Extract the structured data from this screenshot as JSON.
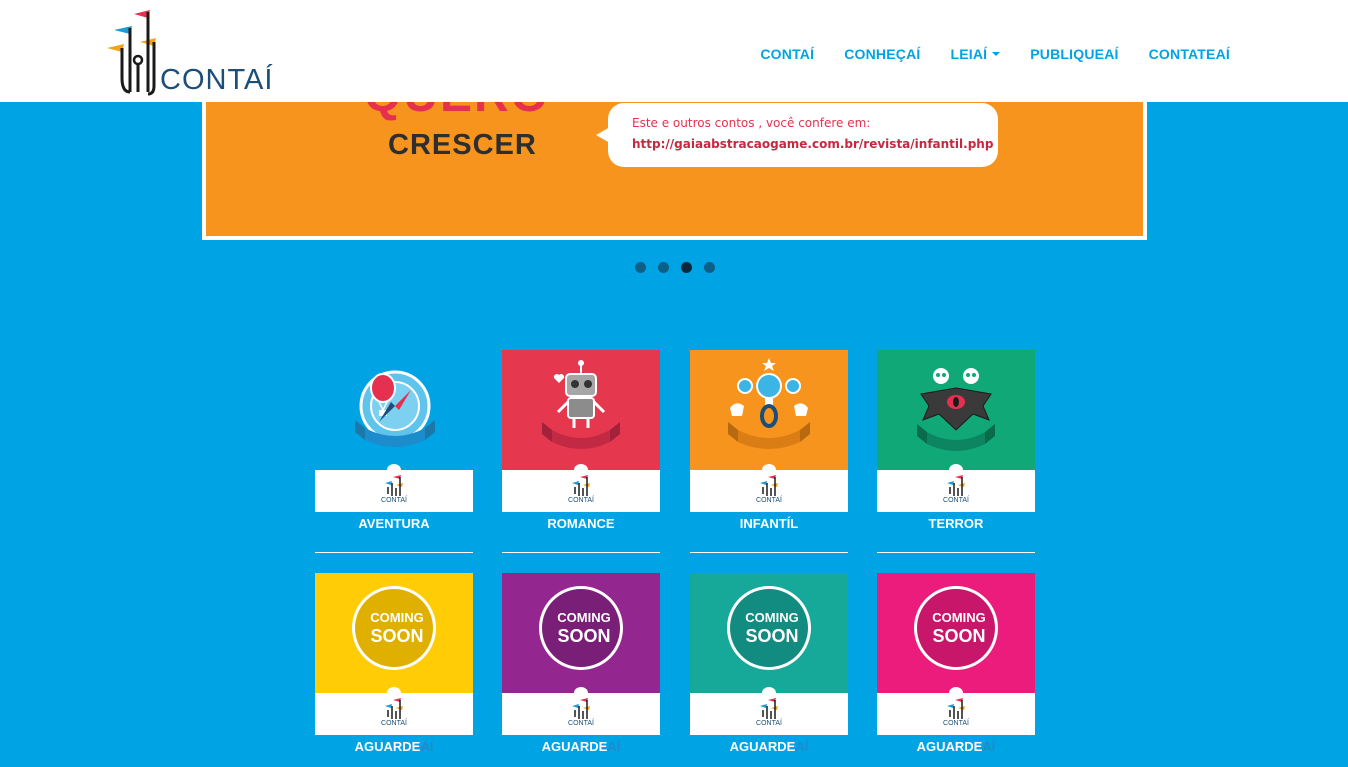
{
  "brand": {
    "name": "CONTAÍ"
  },
  "nav": {
    "items": [
      {
        "label": "CONTAÍ"
      },
      {
        "label": "CONHEÇAÍ"
      },
      {
        "label": "LEIAÍ"
      },
      {
        "label": "PUBLIQUEAÍ"
      },
      {
        "label": "CONTATEAÍ"
      }
    ]
  },
  "carousel": {
    "slide": {
      "title_line1": "QUERO",
      "title_line2": "CRESCER",
      "bubble_line1": "Este e outros contos , você confere em:",
      "bubble_line2": "http://gaiaabstracaogame.com.br/revista/infantil.php"
    },
    "active_index": 2,
    "count": 4
  },
  "categories": [
    {
      "label": "AVENTURA",
      "badge": "AVENTURA",
      "color": "#00a3e4",
      "icon": "hot-air-balloon-icon"
    },
    {
      "label": "ROMANCE",
      "badge": "ROMANCE",
      "color": "#e5384f",
      "icon": "robot-heart-icon"
    },
    {
      "label": "INFANTÍL",
      "badge": "INFANTIL",
      "color": "#f7941e",
      "icon": "baby-rattle-icon"
    },
    {
      "label": "TERROR",
      "badge": "TERROR",
      "color": "#0fa876",
      "icon": "bat-monster-icon"
    }
  ],
  "coming_soon": [
    {
      "label_main": "AGUARDE",
      "label_suffix": "AÍ",
      "color": "#ffcc05",
      "badge_line1": "COMING",
      "badge_line2": "SOON"
    },
    {
      "label_main": "AGUARDE",
      "label_suffix": "AÍ",
      "color": "#93278f",
      "badge_line1": "COMING",
      "badge_line2": "SOON"
    },
    {
      "label_main": "AGUARDE",
      "label_suffix": "AÍ",
      "color": "#16a99a",
      "badge_line1": "COMING",
      "badge_line2": "SOON"
    },
    {
      "label_main": "AGUARDE",
      "label_suffix": "AÍ",
      "color": "#ec1c7d",
      "badge_line1": "COMING",
      "badge_line2": "SOON"
    }
  ],
  "mini_logo_text": "CONTAÍ"
}
